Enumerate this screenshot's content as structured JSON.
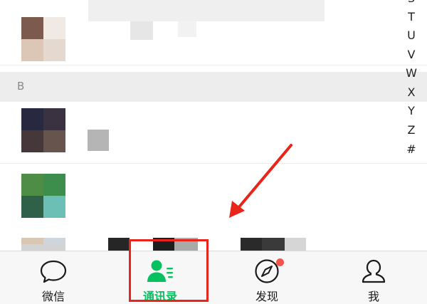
{
  "contacts": {
    "section_letter": "B",
    "rows": [
      {
        "avatar_colors": [
          "#7c5a4e",
          "#f1e9e4",
          "#dcc7b6",
          "#e4d8cf"
        ]
      },
      {
        "avatar_colors": [
          "#292841",
          "#3a3240",
          "#46373a",
          "#67544c"
        ]
      },
      {
        "avatar_colors": [
          "#4e8d45",
          "#3d8e4d",
          "#2f6048",
          "#6cbfb4"
        ]
      },
      {
        "avatar_colors": [
          "#d9c7b4",
          "#cfd5dd",
          "#d3d3d3",
          "#d3d3d3"
        ]
      }
    ]
  },
  "index_bar": {
    "letters": [
      "S",
      "T",
      "U",
      "V",
      "W",
      "X",
      "Y",
      "Z",
      "#"
    ]
  },
  "annotation": {
    "arrow_color": "#e8241b",
    "highlight_color": "#e8241b"
  },
  "tabbar": {
    "tabs": [
      {
        "label": "微信",
        "icon": "chat-bubble-icon"
      },
      {
        "label": "通讯录",
        "icon": "contacts-icon"
      },
      {
        "label": "发现",
        "icon": "compass-icon"
      },
      {
        "label": "我",
        "icon": "person-icon"
      }
    ],
    "active_tab": "通讯录",
    "active_color": "#07c160"
  }
}
